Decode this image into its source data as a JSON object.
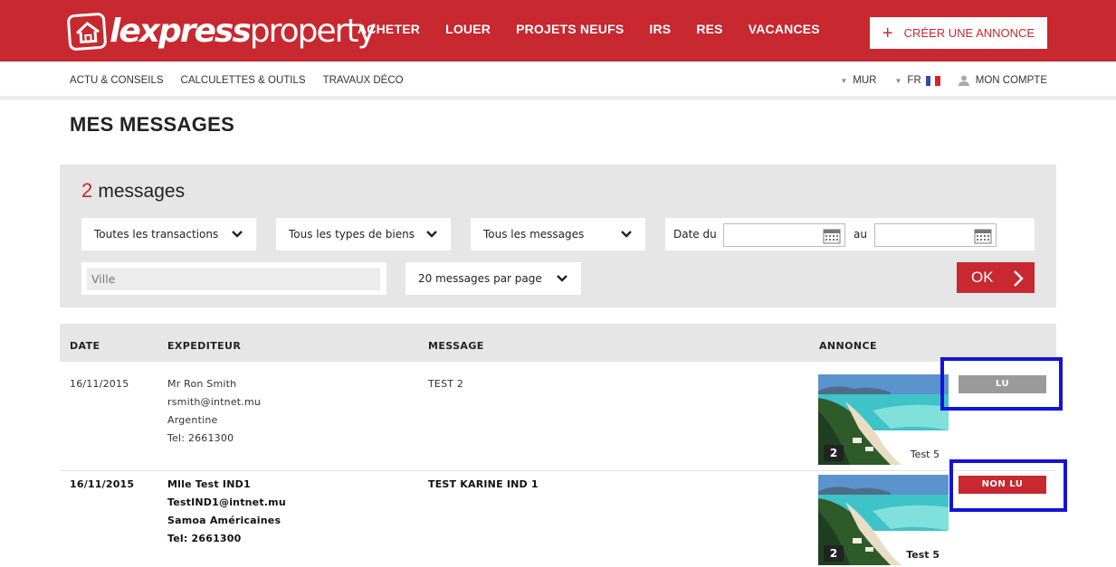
{
  "brand": {
    "bold": "lexpress",
    "light": "property",
    "primary_color": "#c8282f"
  },
  "main_nav": [
    "ACHETER",
    "LOUER",
    "PROJETS NEUFS",
    "IRS",
    "RES",
    "VACANCES"
  ],
  "create_button": {
    "icon": "plus-icon",
    "label": "CRÉER UNE ANNONCE"
  },
  "sub_nav": [
    "ACTU & CONSEILS",
    "CALCULETTES & OUTILS",
    "TRAVAUX DÉCO"
  ],
  "utility": {
    "currency": "MUR",
    "language": "FR",
    "account": "MON COMPTE"
  },
  "page_title": "MES MESSAGES",
  "filter": {
    "count": "2",
    "count_label": "messages",
    "transactions": "Toutes les transactions",
    "property_types": "Tous les types de biens",
    "messages": "Tous les messages",
    "date_from_label": "Date du",
    "date_to_label": "au",
    "city_placeholder": "Ville",
    "per_page": "20 messages par page",
    "ok": "OK"
  },
  "table": {
    "headers": {
      "date": "DATE",
      "sender": "EXPEDITEUR",
      "message": "MESSAGE",
      "listing": "ANNONCE"
    },
    "rows": [
      {
        "date": "16/11/2015",
        "name": "Mr Ron Smith",
        "email": "rsmith@intnet.mu",
        "country": "Argentine",
        "tel": "Tel: 2661300",
        "message": "TEST 2",
        "photo_count": "2",
        "listing_title": "Test 5",
        "status": "LU",
        "status_color": "#9a9a9a"
      },
      {
        "date": "16/11/2015",
        "name": "Mlle Test IND1",
        "email": "TestIND1@intnet.mu",
        "country": "Samoa Américaines",
        "tel": "Tel: 2661300",
        "message": "TEST KARINE IND 1",
        "photo_count": "2",
        "listing_title": "Test 5",
        "status": "NON LU",
        "status_color": "#c8282f"
      }
    ]
  }
}
